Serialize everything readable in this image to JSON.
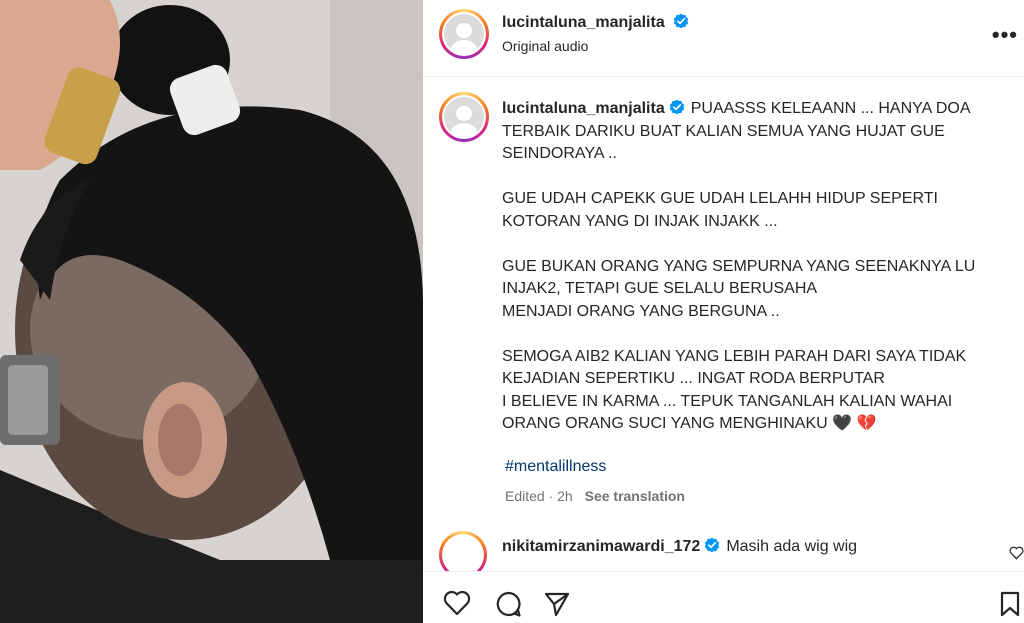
{
  "post": {
    "username": "lucintaluna_manjalita",
    "audio_label": "Original audio",
    "more_label": "•••"
  },
  "caption": {
    "username": "lucintaluna_manjalita",
    "paragraphs": [
      "PUAASSS KELEAANN ... HANYA DOA TERBAIK DARIKU BUAT KALIAN SEMUA YANG HUJAT GUE SEINDORAYA ..",
      "GUE UDAH CAPEKK GUE UDAH LELAHH HIDUP SEPERTI KOTORAN YANG DI INJAK INJAKK ...",
      "GUE BUKAN ORANG YANG SEMPURNA YANG SEENAKNYA LU INJAK2, TETAPI GUE SELALU BERUSAHA",
      "MENJADI ORANG YANG BERGUNA ..",
      "SEMOGA AIB2 KALIAN YANG LEBIH PARAH DARI SAYA TIDAK KEJADIAN SEPERTIKU ... INGAT RODA BERPUTAR",
      "I BELIEVE IN KARMA ... TEPUK TANGANLAH KALIAN WAHAI ORANG ORANG SUCI YANG MENGHINAKU 🖤 💔"
    ],
    "hashtag": "#mentalillness",
    "edited": "Edited · 2h",
    "see_translation": "See translation"
  },
  "comment": {
    "username": "nikitamirzanimawardi_172",
    "text": "Masih ada wig wig"
  },
  "actions": [
    "heart-icon",
    "comment-icon",
    "share-icon",
    "bookmark-icon"
  ],
  "colors": {
    "link": "#00376b",
    "verified": "#0095f6",
    "muted": "#737373"
  }
}
